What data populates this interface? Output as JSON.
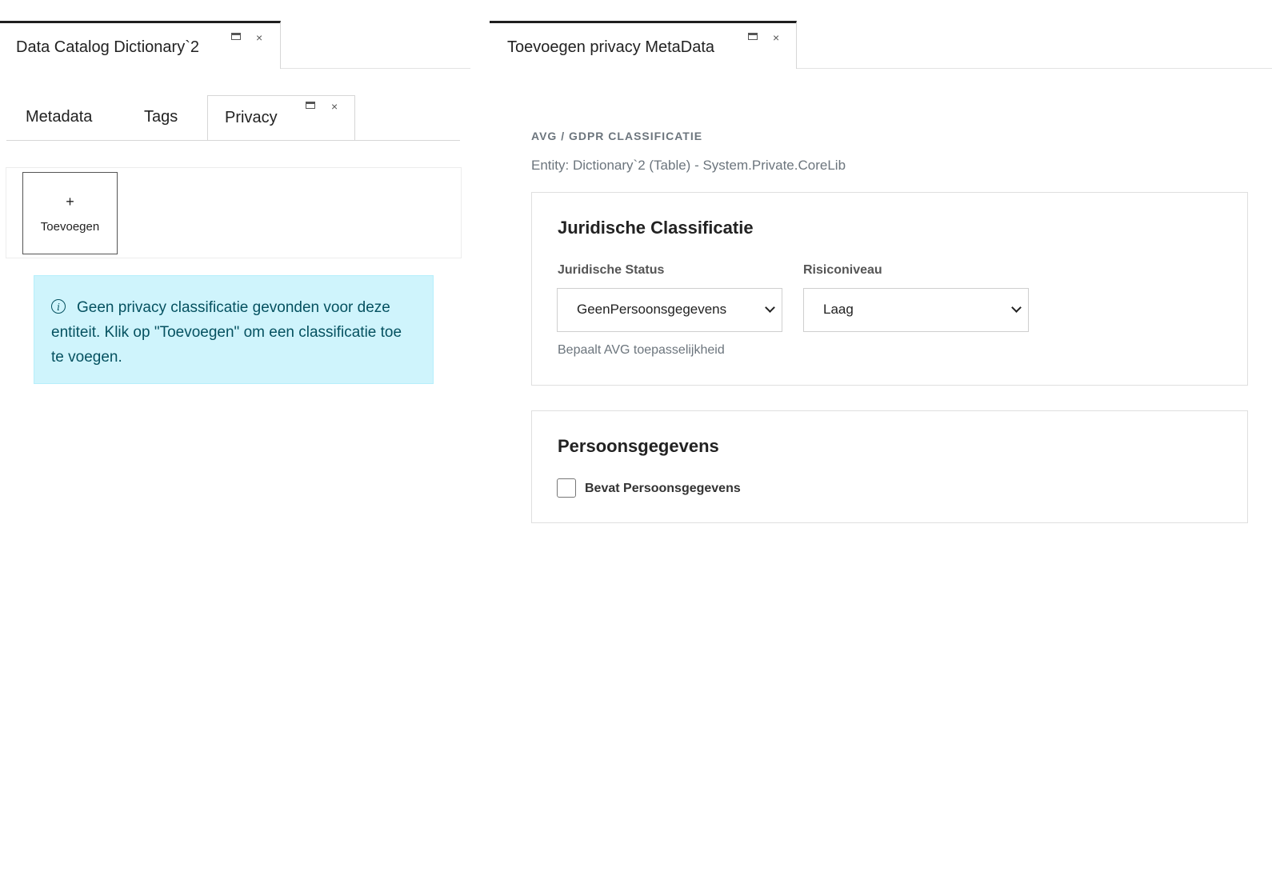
{
  "left_pane": {
    "doc_tab_title": "Data Catalog Dictionary`2",
    "inner_tabs": [
      {
        "label": "Metadata"
      },
      {
        "label": "Tags"
      },
      {
        "label": "Privacy"
      }
    ],
    "add_button": {
      "icon": "+",
      "label": "Toevoegen"
    },
    "alert": {
      "icon": "info-icon",
      "text": "Geen privacy classificatie gevonden voor deze entiteit. Klik op \"Toevoegen\" om een classificatie toe te voegen."
    }
  },
  "right_pane": {
    "doc_tab_title": "Toevoegen privacy MetaData",
    "section_kicker": "AVG / GDPR CLASSIFICATIE",
    "entity_line": "Entity: Dictionary`2 (Table) - System.Private.CoreLib",
    "legal_card": {
      "title": "Juridische Classificatie",
      "status_label": "Juridische Status",
      "status_value": "GeenPersoonsgegevens",
      "status_help": "Bepaalt AVG toepasselijkheid",
      "risk_label": "Risiconiveau",
      "risk_value": "Laag"
    },
    "personal_card": {
      "title": "Persoonsgegevens",
      "checkbox_label": "Bevat Persoonsgegevens",
      "checkbox_checked": false
    }
  },
  "icons": {
    "tab_window": "window-icon",
    "tab_close": "×"
  },
  "colors": {
    "alert_bg": "#cff4fc",
    "alert_text": "#055160",
    "tab_accent": "#1f1f1f"
  }
}
